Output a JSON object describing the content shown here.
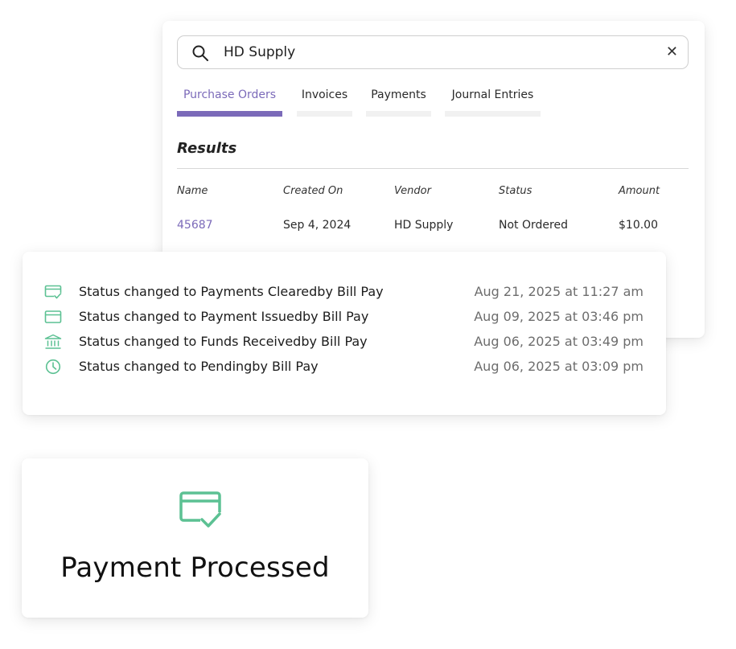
{
  "search": {
    "query": "HD Supply",
    "clear_icon": "close-icon",
    "search_icon": "search-icon"
  },
  "tabs": [
    {
      "label": "Purchase Orders",
      "active": true
    },
    {
      "label": "Invoices",
      "active": false
    },
    {
      "label": "Payments",
      "active": false
    },
    {
      "label": "Journal Entries",
      "active": false
    }
  ],
  "results": {
    "title": "Results",
    "columns": [
      "Name",
      "Created On",
      "Vendor",
      "Status",
      "Amount"
    ],
    "rows": [
      {
        "name": "45687",
        "created_on": "Sep 4, 2024",
        "vendor": "HD Supply",
        "status": "Not Ordered",
        "amount": "$10.00"
      }
    ]
  },
  "activity": [
    {
      "icon": "card-check-icon",
      "text": "Status changed to Payments Clearedby Bill Pay",
      "time": "Aug 21, 2025 at 11:27 am"
    },
    {
      "icon": "credit-card-icon",
      "text": "Status changed to Payment Issuedby Bill Pay",
      "time": "Aug 09, 2025 at 03:46 pm"
    },
    {
      "icon": "bank-icon",
      "text": "Status changed to Funds Receivedby Bill Pay",
      "time": "Aug 06, 2025 at 03:49 pm"
    },
    {
      "icon": "clock-icon",
      "text": "Status changed to Pendingby Bill Pay",
      "time": "Aug 06, 2025 at 03:09 pm"
    }
  ],
  "payment": {
    "icon": "card-check-icon",
    "title": "Payment Processed"
  },
  "colors": {
    "accent": "#7b6ab9",
    "status_icon": "#5cc193",
    "muted_text": "#6d6d6d"
  }
}
